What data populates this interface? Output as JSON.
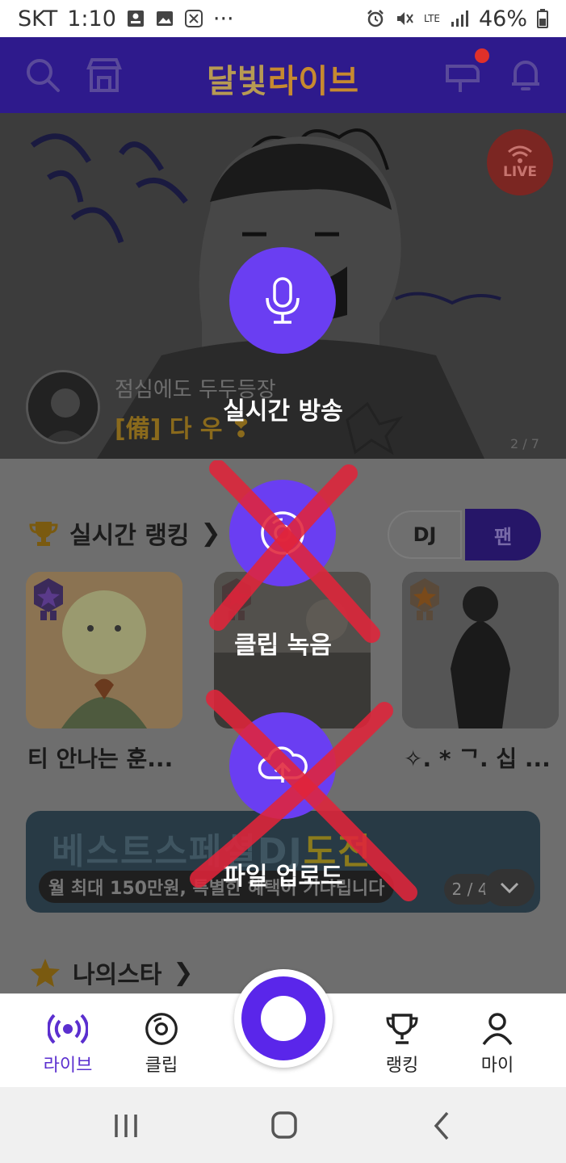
{
  "status_bar": {
    "carrier": "SKT",
    "time": "1:10",
    "dots": "···",
    "network": "LTE",
    "battery": "46%"
  },
  "header": {
    "title_part1": "달빛",
    "title_part2": "라이브",
    "icons": [
      "search-icon",
      "store-icon",
      "mailbox-icon",
      "bell-icon"
    ]
  },
  "banner": {
    "live_badge": "LIVE",
    "subtitle": "점심에도 두두등장",
    "name": "[備] 다 우 ❣",
    "page": "2 / 7"
  },
  "ranking": {
    "title": "실시간 랭킹",
    "chevron": "❯",
    "toggle_dj": "DJ",
    "toggle_fan": "팬",
    "cards": [
      {
        "label": "티 안나는 훈..."
      },
      {
        "label": ""
      },
      {
        "label": "✧. * ᄀ. 십 ..."
      }
    ]
  },
  "event": {
    "title_part1": "베스트스페셜DJ",
    "title_part2": "도전",
    "subtitle": "월 최대 150만원, 특별한 혜택이 기다립니다",
    "page": "2 / 4"
  },
  "my_star": {
    "title": "나의스타",
    "chevron": "❯"
  },
  "action_menu": {
    "live_broadcast": "실시간 방송",
    "clip_recording": "클립 녹음",
    "file_upload": "파일 업로드"
  },
  "bottom_nav": {
    "live": "라이브",
    "clip": "클립",
    "ranking": "랭킹",
    "my": "마이"
  },
  "colors": {
    "brand_purple": "#6a3ef2",
    "header_bg": "#2e1a8c",
    "active_nav": "#5b2fcf",
    "cross_red": "#e0243a"
  }
}
